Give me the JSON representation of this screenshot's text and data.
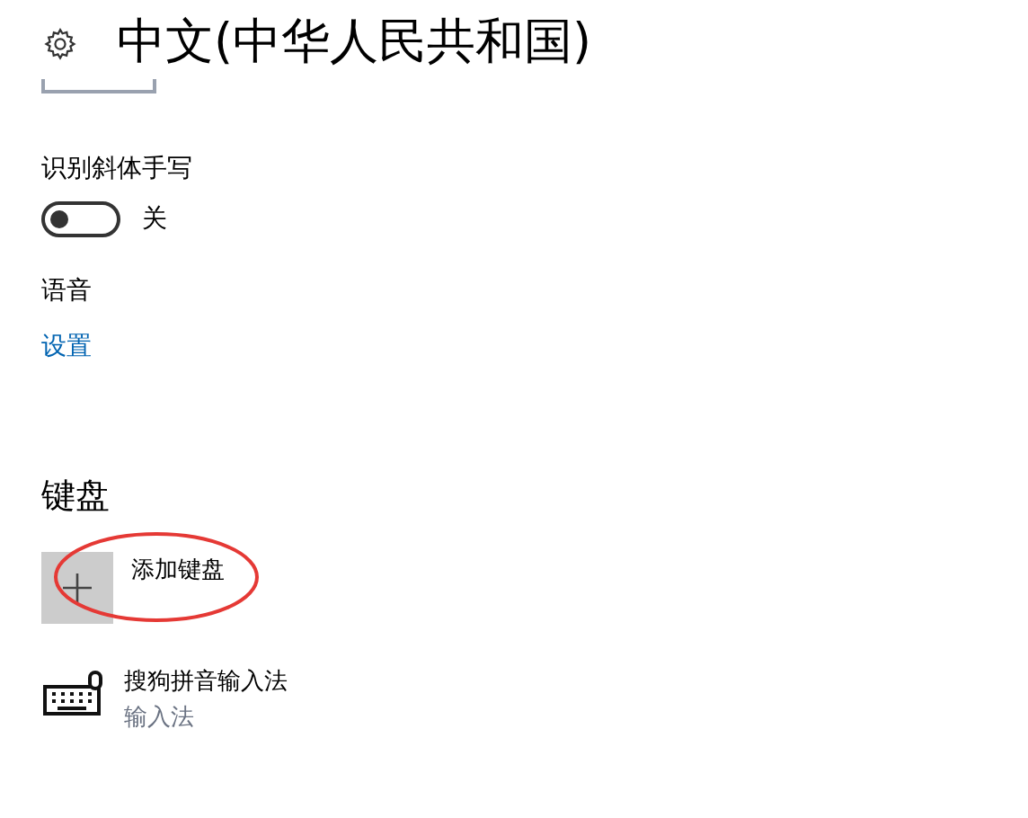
{
  "header": {
    "title": "中文(中华人民共和国)"
  },
  "handwriting": {
    "label": "识别斜体手写",
    "on": false,
    "state_text": "关"
  },
  "speech": {
    "label": "语音",
    "link": "设置"
  },
  "keyboard": {
    "heading": "键盘",
    "add_label": "添加键盘",
    "highlighted": true,
    "items": [
      {
        "name": "搜狗拼音输入法",
        "type": "输入法"
      }
    ]
  }
}
